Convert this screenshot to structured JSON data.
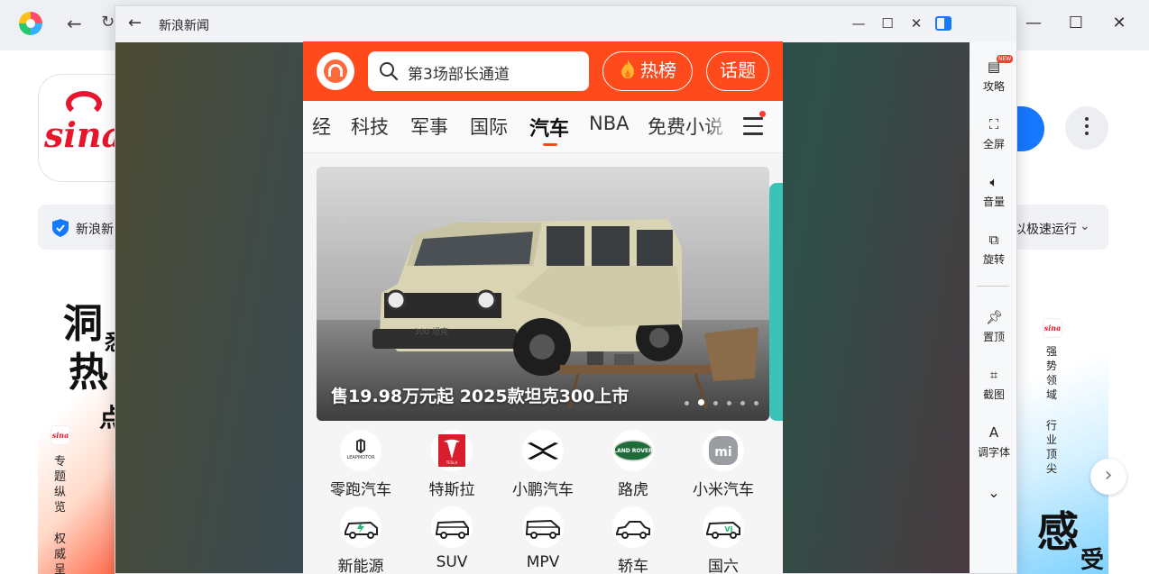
{
  "emulator": {
    "title": "新浪新闻"
  },
  "store": {
    "info_left": "新浪新闻",
    "info_right": "以极速运行",
    "promo_left_big": [
      "洞",
      "热"
    ],
    "promo_left_partial": [
      "悉",
      "点"
    ],
    "promo_left_small": [
      "专",
      "题",
      "纵",
      "览",
      "权",
      "威",
      "呈"
    ],
    "promo_right_small": [
      "强",
      "势",
      "领",
      "域",
      "",
      "行",
      "业",
      "顶",
      "尖"
    ],
    "promo_right_big": [
      "感",
      "受"
    ]
  },
  "sidebar": {
    "items": [
      {
        "label": "攻略",
        "icon": "guide-icon",
        "badge": "NEW"
      },
      {
        "label": "全屏",
        "icon": "fullscreen-icon"
      },
      {
        "label": "音量",
        "icon": "volume-icon"
      },
      {
        "label": "旋转",
        "icon": "rotate-icon"
      },
      {
        "label": "置顶",
        "icon": "pin-icon"
      },
      {
        "label": "截图",
        "icon": "crop-icon"
      },
      {
        "label": "调字体",
        "icon": "font-icon"
      }
    ]
  },
  "phone": {
    "search_text": "第3场部长通道",
    "hot_label": "热榜",
    "topic_label": "话题",
    "tabs": [
      "经",
      "科技",
      "军事",
      "国际",
      "汽车",
      "NBA",
      "免费小说"
    ],
    "active_tab": "汽车",
    "banner": {
      "caption": "售19.98万元起 2025款坦克300上市",
      "plate": "300 坦克",
      "slide_count": 6,
      "active_slide": 2
    },
    "brands": [
      {
        "label": "零跑汽车",
        "logo_text": "LEAPMOTOR"
      },
      {
        "label": "特斯拉",
        "logo_text": "TESLA"
      },
      {
        "label": "小鹏汽车",
        "logo_text": ""
      },
      {
        "label": "路虎",
        "logo_text": "LAND ROVER"
      },
      {
        "label": "小米汽车",
        "logo_text": "mi"
      }
    ],
    "types": [
      {
        "label": "新能源"
      },
      {
        "label": "SUV"
      },
      {
        "label": "MPV"
      },
      {
        "label": "轿车"
      },
      {
        "label": "国六",
        "logo_text": "VI"
      }
    ]
  },
  "colors": {
    "header_red": "#ff4a1c",
    "store_blue": "#1677ff",
    "sina_red": "#e6162d"
  }
}
